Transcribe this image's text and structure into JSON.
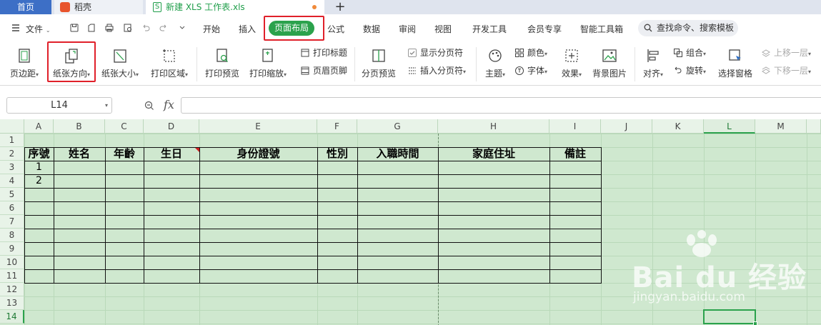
{
  "tabs": {
    "home": "首页",
    "daoke": "稻壳",
    "file": "新建 XLS 工作表.xls",
    "file_icon": "S",
    "add": "+"
  },
  "menu": {
    "file": "文件",
    "items": [
      "开始",
      "插入",
      "页面布局",
      "公式",
      "数据",
      "审阅",
      "视图",
      "开发工具",
      "会员专享",
      "智能工具箱"
    ],
    "active": "页面布局",
    "search_placeholder": "查找命令、搜索模板"
  },
  "ribbon": {
    "margins": "页边距",
    "orientation": "纸张方向",
    "size": "纸张大小",
    "print_area": "打印区域",
    "print_preview": "打印预览",
    "print_scale": "打印缩放",
    "print_titles": "打印标题",
    "header_footer": "页眉页脚",
    "page_break_preview": "分页预览",
    "show_page_breaks": "显示分页符",
    "insert_page_break": "插入分页符",
    "theme": "主题",
    "colors": "颜色",
    "fonts": "字体",
    "effects": "效果",
    "background": "背景图片",
    "align": "对齐",
    "group": "组合",
    "rotate": "旋转",
    "selection_pane": "选择窗格",
    "bring_forward": "上移一层",
    "send_backward": "下移一层"
  },
  "formula_bar": {
    "name_box": "L14",
    "fx": "fx",
    "value": ""
  },
  "sheet": {
    "columns": [
      "A",
      "B",
      "C",
      "D",
      "E",
      "F",
      "G",
      "H",
      "I",
      "J",
      "K",
      "L",
      "M"
    ],
    "rows": [
      "1",
      "2",
      "3",
      "4",
      "5",
      "6",
      "7",
      "8",
      "9",
      "10",
      "11",
      "12",
      "13",
      "14"
    ],
    "selected_cell": "L14",
    "table_headers": [
      "序號",
      "姓名",
      "年齡",
      "生日",
      "身份證號",
      "性別",
      "入職時間",
      "家庭住址",
      "備註"
    ],
    "table_rows": [
      [
        "1"
      ],
      [
        "2"
      ]
    ]
  },
  "watermark": {
    "text": "Bai du 经验",
    "sub": "jingyan.baidu.com"
  },
  "colors": {
    "accent": "#2ba24c",
    "sheet_bg": "#cfe8cf",
    "highlight": "#e0202a"
  }
}
